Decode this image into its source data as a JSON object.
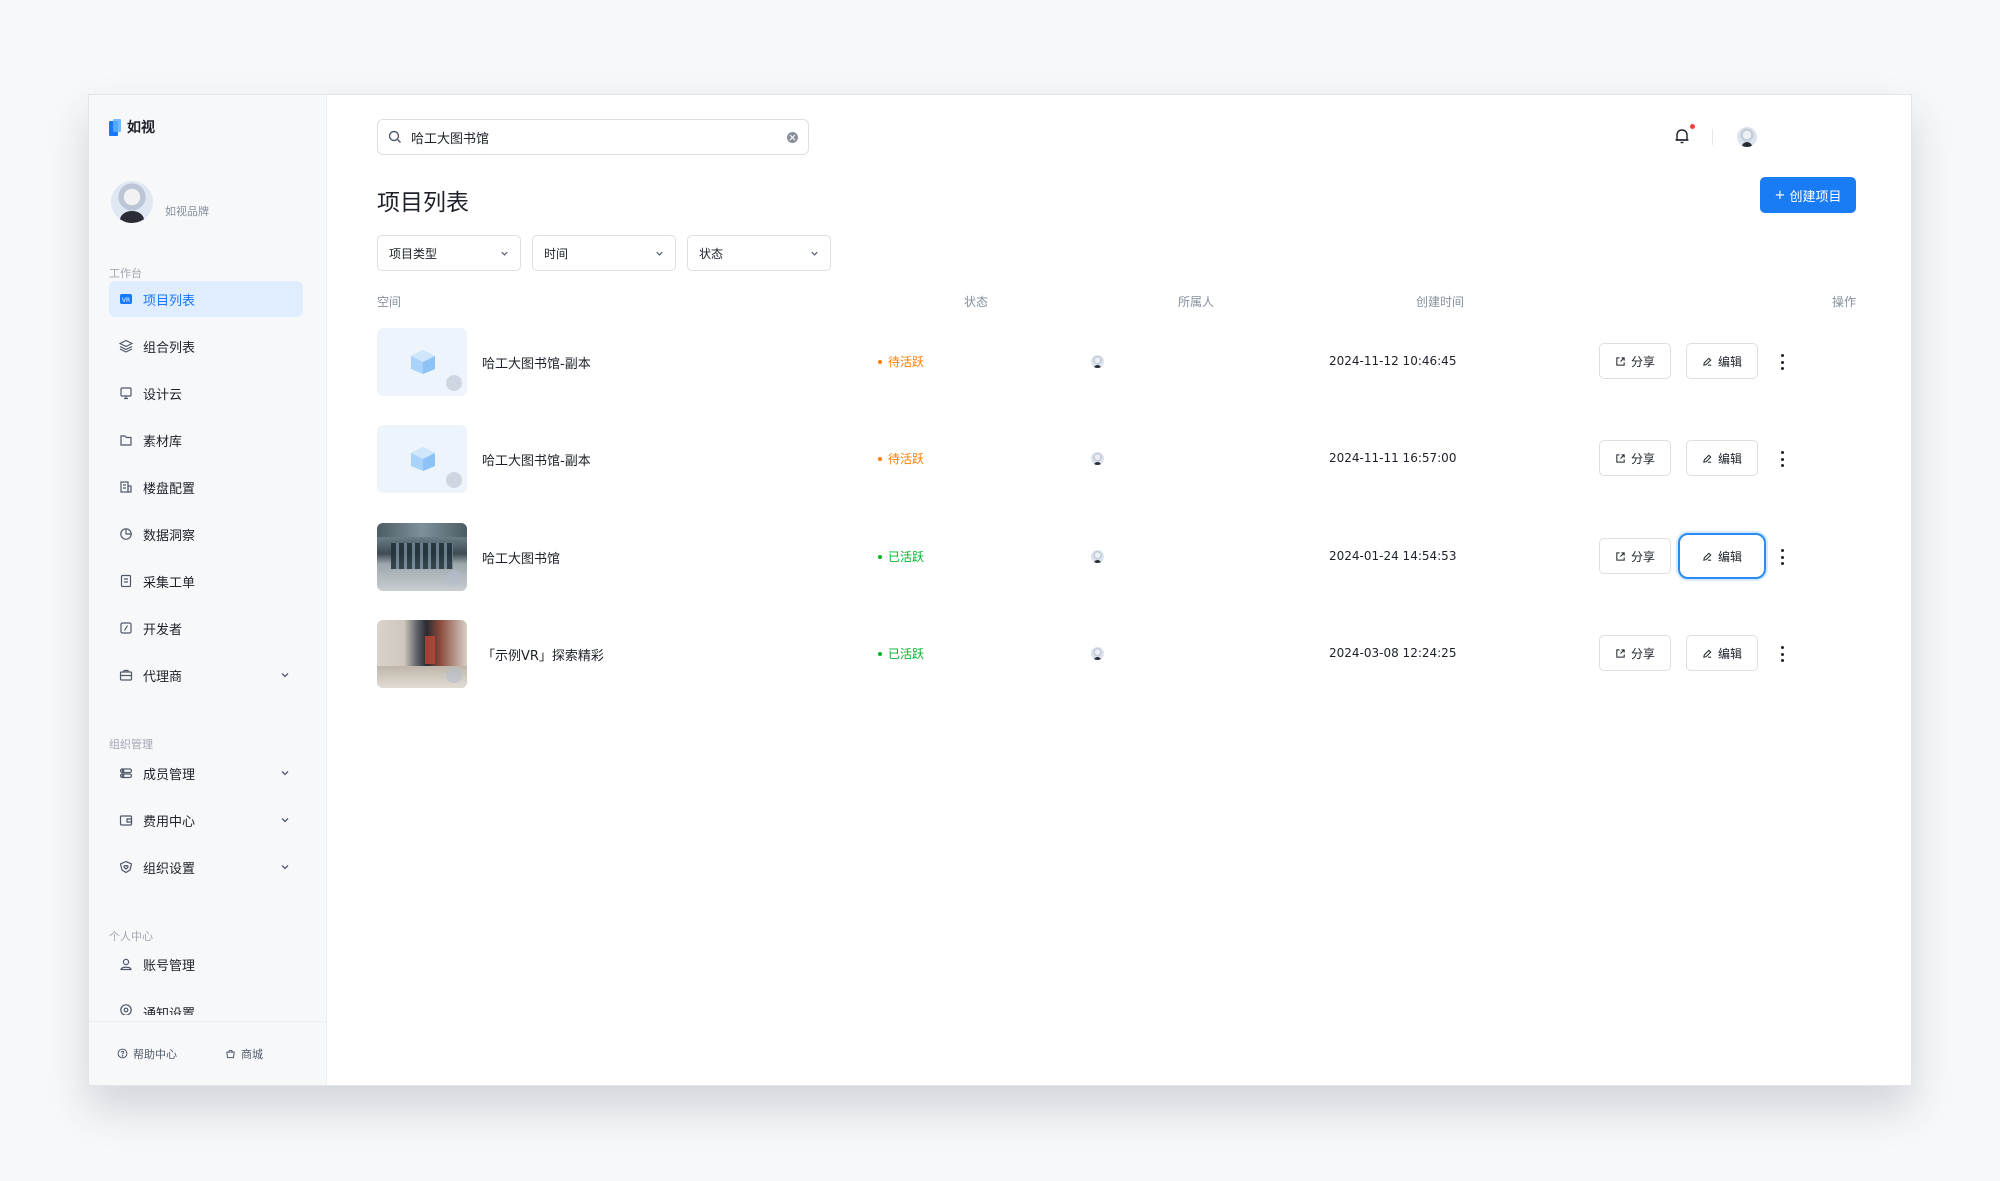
{
  "app": {
    "logo_text": "如视"
  },
  "profile": {
    "name": "如视品牌"
  },
  "sidebar": {
    "workspace_label": "工作台",
    "workspace_items": [
      {
        "label": "项目列表",
        "icon": "vr-icon",
        "active": true
      },
      {
        "label": "组合列表",
        "icon": "layers-icon"
      },
      {
        "label": "设计云",
        "icon": "monitor-icon"
      },
      {
        "label": "素材库",
        "icon": "folder-icon"
      },
      {
        "label": "楼盘配置",
        "icon": "building-icon"
      },
      {
        "label": "数据洞察",
        "icon": "pie-chart-icon"
      },
      {
        "label": "采集工单",
        "icon": "clipboard-icon"
      },
      {
        "label": "开发者",
        "icon": "code-icon"
      },
      {
        "label": "代理商",
        "icon": "briefcase-icon",
        "expandable": true
      }
    ],
    "org_label": "组织管理",
    "org_items": [
      {
        "label": "成员管理",
        "icon": "members-icon",
        "expandable": true
      },
      {
        "label": "费用中心",
        "icon": "wallet-icon",
        "expandable": true
      },
      {
        "label": "组织设置",
        "icon": "shield-heart-icon",
        "expandable": true
      }
    ],
    "personal_label": "个人中心",
    "personal_items": [
      {
        "label": "账号管理",
        "icon": "user-icon"
      },
      {
        "label": "通知设置",
        "icon": "notification-settings-icon"
      }
    ],
    "footer": {
      "help": "帮助中心",
      "store": "商城"
    }
  },
  "search": {
    "value": "哈工大图书馆"
  },
  "header": {
    "title": "项目列表",
    "create_button": "创建项目"
  },
  "filters": [
    {
      "label": "项目类型"
    },
    {
      "label": "时间"
    },
    {
      "label": "状态"
    }
  ],
  "table": {
    "columns": {
      "space": "空间",
      "status": "状态",
      "owner": "所属人",
      "created": "创建时间",
      "actions": "操作"
    },
    "share_label": "分享",
    "edit_label": "编辑",
    "rows": [
      {
        "name": "哈工大图书馆-副本",
        "status": "待活跃",
        "status_color": "#ff7d00",
        "created": "2024-11-12 10:46:45",
        "thumb": "placeholder"
      },
      {
        "name": "哈工大图书馆-副本",
        "status": "待活跃",
        "status_color": "#ff7d00",
        "created": "2024-11-11 16:57:00",
        "thumb": "placeholder"
      },
      {
        "name": "哈工大图书馆",
        "status": "已活跃",
        "status_color": "#00b42a",
        "created": "2024-01-24 14:54:53",
        "thumb": "photo1"
      },
      {
        "name": "「示例VR」探索精彩",
        "status": "已活跃",
        "status_color": "#00b42a",
        "created": "2024-03-08 12:24:25",
        "thumb": "photo2"
      }
    ]
  },
  "colors": {
    "accent": "#1a7cf5",
    "pending": "#ff7d00",
    "active": "#00b42a"
  }
}
